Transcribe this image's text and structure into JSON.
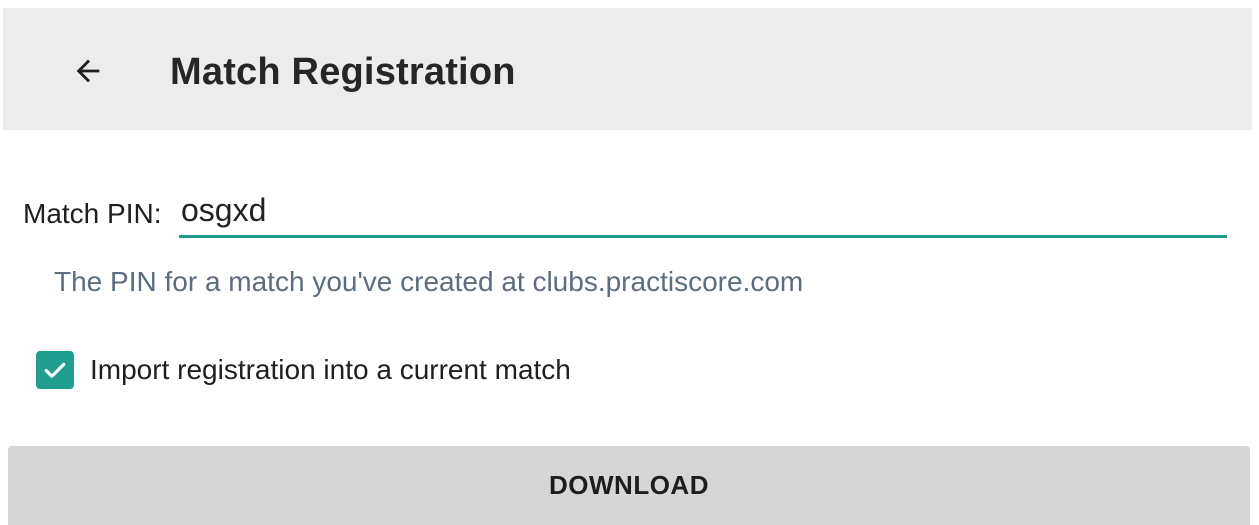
{
  "app_bar": {
    "back_icon": "arrow-left-icon",
    "title": "Match Registration"
  },
  "form": {
    "pin_label": "Match PIN:",
    "pin_value": "osgxd",
    "helper_text": "The PIN for a match you've created at clubs.practiscore.com",
    "import_checkbox": {
      "checked": true,
      "label": "Import registration into a current match"
    },
    "download_label": "DOWNLOAD"
  },
  "colors": {
    "app_bar_bg": "#ececec",
    "accent": "#209e8f",
    "helper_text": "#5c6d80",
    "button_bg": "#d6d6d6"
  }
}
